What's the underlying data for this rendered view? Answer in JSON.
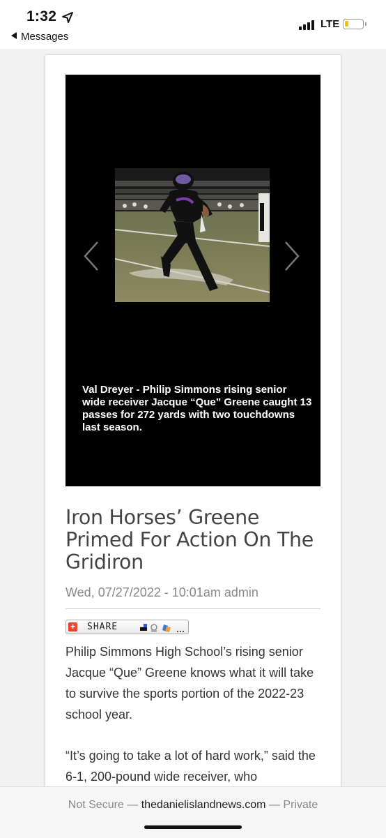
{
  "status_bar": {
    "time": "1:32",
    "back_label": "Messages",
    "carrier": "LTE"
  },
  "colors": {
    "battery": "#f5c400",
    "title": "#444444",
    "meta": "#888888",
    "share_plus": "#e8462e"
  },
  "article": {
    "caption": "Val Dreyer - Philip Simmons rising senior wide receiver Jacque “Que” Greene caught 13 passes for 272 yards with two touchdowns last season.",
    "title": "Iron Horses’ Greene Primed For Action On The Gridiron",
    "meta": "Wed, 07/27/2022 - 10:01am admin",
    "share_label": "SHARE",
    "paragraphs": [
      "Philip Simmons High School’s rising senior Jacque “Que” Greene knows what it will take to survive the sports portion of the 2022-23 school year.",
      "“It’s going to take a lot of hard work,” said the 6-1, 200-pound wide receiver, who"
    ]
  },
  "browser": {
    "security": "Not Secure",
    "domain": "thedanielislandnews.com",
    "mode": "Private",
    "separator": "—"
  }
}
